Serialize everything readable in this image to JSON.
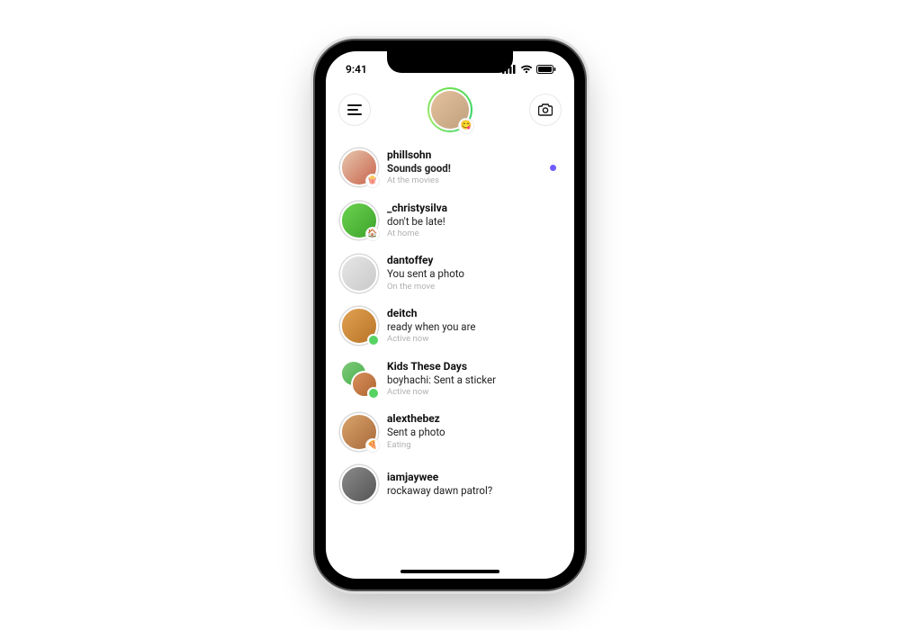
{
  "status_bar": {
    "time": "9:41"
  },
  "header": {
    "menu_icon": "menu-icon",
    "camera_icon": "camera-icon",
    "profile_status_emoji": "😋"
  },
  "colors": {
    "unread_dot": "#6e5cff",
    "story_ring": "#56d363"
  },
  "threads": [
    {
      "username": "phillsohn",
      "message": "Sounds good!",
      "message_bold": true,
      "substatus": "At the movies",
      "badge_emoji": "🍿",
      "unread": true,
      "avatar_class": "g1",
      "group": false
    },
    {
      "username": "_christysilva",
      "message": "don't be late!",
      "message_bold": false,
      "substatus": "At home",
      "badge_emoji": "🏠",
      "unread": false,
      "avatar_class": "g2",
      "group": false
    },
    {
      "username": "dantoffey",
      "message": "You sent a photo",
      "message_bold": false,
      "substatus": "On the move",
      "badge_emoji": "",
      "unread": false,
      "avatar_class": "g3",
      "group": false
    },
    {
      "username": "deitch",
      "message": "ready when you are",
      "message_bold": false,
      "substatus": "Active now",
      "badge_emoji": "green-dot",
      "unread": false,
      "avatar_class": "g4",
      "group": false
    },
    {
      "username": "Kids These Days",
      "message": "boyhachi: Sent a sticker",
      "message_bold": false,
      "substatus": "Active now",
      "badge_emoji": "green-dot",
      "unread": false,
      "avatar_class": "",
      "group": true
    },
    {
      "username": "alexthebez",
      "message": "Sent a photo",
      "message_bold": false,
      "substatus": "Eating",
      "badge_emoji": "🍕",
      "unread": false,
      "avatar_class": "g6",
      "group": false
    },
    {
      "username": "iamjaywee",
      "message": "rockaway dawn patrol?",
      "message_bold": false,
      "substatus": "",
      "badge_emoji": "",
      "unread": false,
      "avatar_class": "g7",
      "group": false
    }
  ]
}
